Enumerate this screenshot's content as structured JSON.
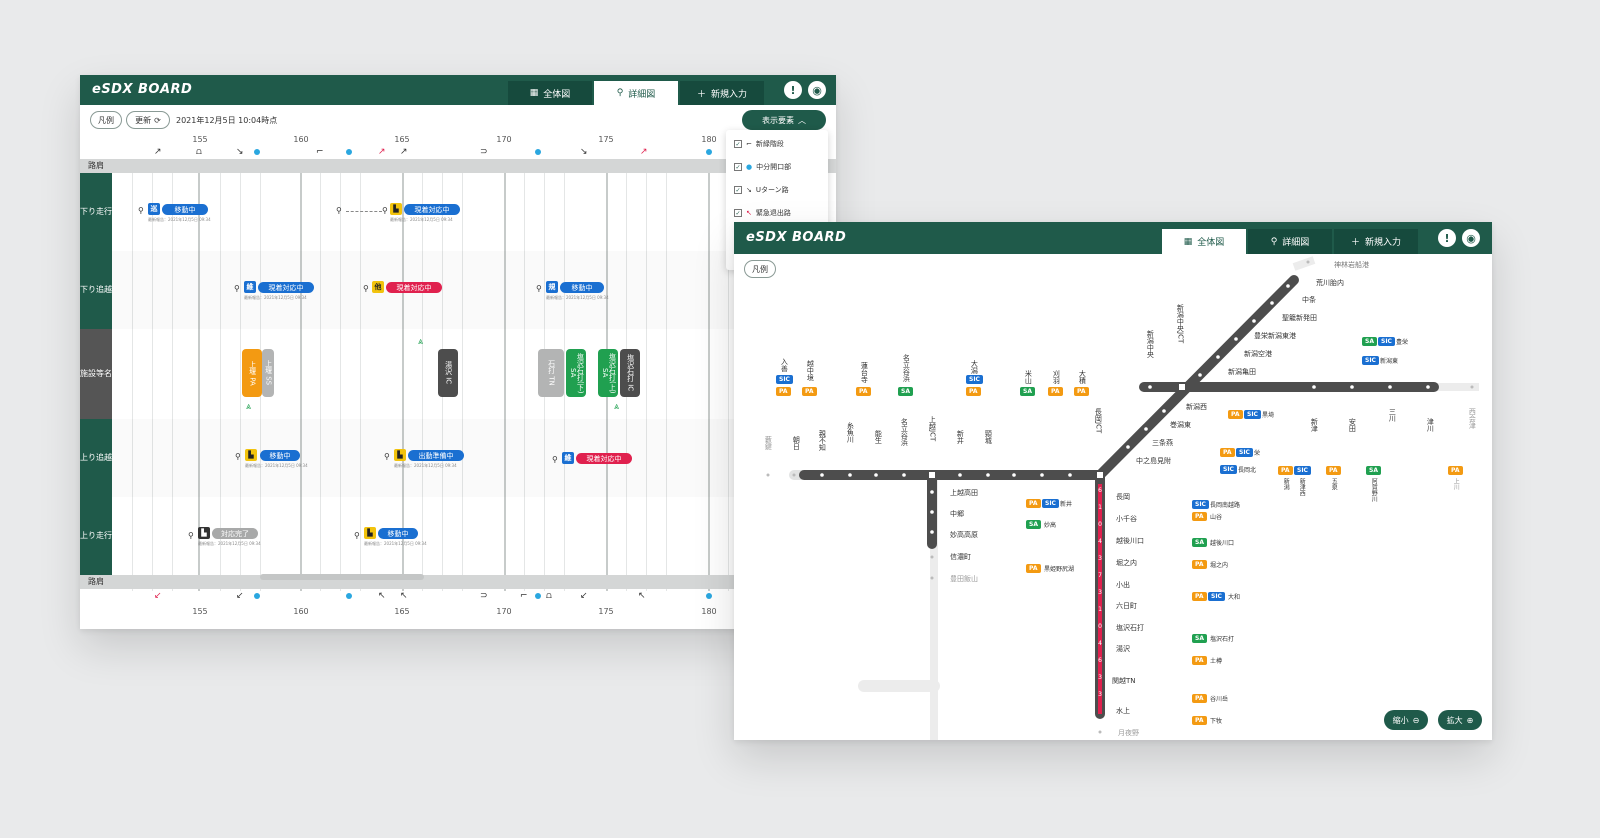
{
  "app": {
    "title": "eSDX BOARD",
    "tabs": [
      {
        "label": "全体図",
        "icon": "map-icon"
      },
      {
        "label": "詳細図",
        "icon": "pin-icon"
      },
      {
        "label": "新規入力",
        "icon": "plus-icon"
      }
    ],
    "alert_icon": "!",
    "user_icon": "user-icon"
  },
  "detail": {
    "legend_btn": "凡例",
    "refresh_btn": "更新",
    "timestamp": "2021年12月5日 10:04時点",
    "display_btn": "表示要素",
    "km_top": [
      "155",
      "160",
      "165",
      "170",
      "175",
      "180"
    ],
    "km_bottom": [
      "155",
      "160",
      "165",
      "170",
      "175",
      "180"
    ],
    "shoulder_label": "路肩",
    "rows": [
      {
        "label": "下り走行"
      },
      {
        "label": "下り追越"
      },
      {
        "label": "施設等名"
      },
      {
        "label": "上り追越"
      },
      {
        "label": "上り走行"
      }
    ],
    "dropdown": [
      {
        "label": "新緑階段",
        "checked": true
      },
      {
        "label": "中分開口部",
        "checked": true
      },
      {
        "label": "Uターン路",
        "checked": true
      },
      {
        "label": "緊急退出路",
        "checked": true
      }
    ],
    "statuses": {
      "r1a": "移動中",
      "r1b": "現着対応中",
      "r2a": "現着対応中",
      "r2b": "現着対応中",
      "r2c": "移動中",
      "r4a": "移動中",
      "r4b": "出動準備中",
      "r4c": "現着対応中",
      "r5a": "対応完了",
      "r5b": "移動中"
    },
    "vehicle_tags": {
      "v1": "巡",
      "v2": "",
      "v3": "維",
      "v4": "他",
      "v5": "規",
      "v6": "",
      "v7": "",
      "v8": "維",
      "v9": "",
      "v10": ""
    },
    "subtext": "最新報告：2021年12月5日 09:34",
    "facilities": {
      "f1": "上堰 PA",
      "f2": "上堰 SS",
      "f3": "湯沢 IC",
      "f4": "石打 TN",
      "f5": "塩沢石打(下) SA",
      "f6": "塩沢石打(上) SA",
      "f7": "塩沢石打 IC"
    }
  },
  "overview": {
    "legend_btn": "凡例",
    "zoom_out": "縮小",
    "zoom_in": "拡大",
    "stations_horizontal_left": [
      "藪鍵",
      "朝日",
      "頸城",
      "新井",
      "上越JCT",
      "名立谷浜",
      "能生",
      "糸魚川",
      "親不知",
      "朝日"
    ],
    "stations_upper": [
      "入善",
      "越中境",
      "蓮台寺",
      "名立谷浜",
      "大潟",
      "米山",
      "刈羽",
      "大積"
    ],
    "branch_stations": [
      "上越高田",
      "中郷",
      "妙高高原",
      "信濃町",
      "豊田飯山"
    ],
    "kanetsu": [
      "長岡",
      "小千谷",
      "越後川口",
      "堀之内",
      "小出",
      "六日町",
      "塩沢石打",
      "湯沢",
      "関越TN",
      "水上",
      "月夜野"
    ],
    "diagonal": [
      "神林岩船港",
      "荒川胎内",
      "中条",
      "聖籠新発田",
      "豊栄新潟東港",
      "新潟空港",
      "新潟亀田",
      "新潟西",
      "巻潟東",
      "三条燕",
      "中之島見附",
      "長岡JCT",
      "新潟中央JCT",
      "新潟中央"
    ],
    "east": [
      "新津",
      "安田",
      "三川",
      "津川",
      "西会津",
      "新潟",
      "新津西",
      "五泉",
      "阿賀野川",
      "上川"
    ],
    "side_labels": {
      "s1": "黒埼",
      "s2": "豊栄",
      "s3": "新潟東",
      "s4": "栄",
      "s5": "長岡北",
      "s6": "新井",
      "s7": "妙高",
      "s8": "長岡南越路",
      "s9": "山谷",
      "s10": "越後川口",
      "s11": "堀之内",
      "s12": "大和",
      "s13": "塩沢石打",
      "s14": "土樽",
      "s15": "谷川岳",
      "s16": "下牧",
      "s17": "黒姫野尻湖"
    },
    "km_markers": [
      "6",
      "1",
      "0",
      "4",
      "3",
      "7",
      "3",
      "1",
      "0",
      "4",
      "6",
      "3",
      "3"
    ]
  }
}
